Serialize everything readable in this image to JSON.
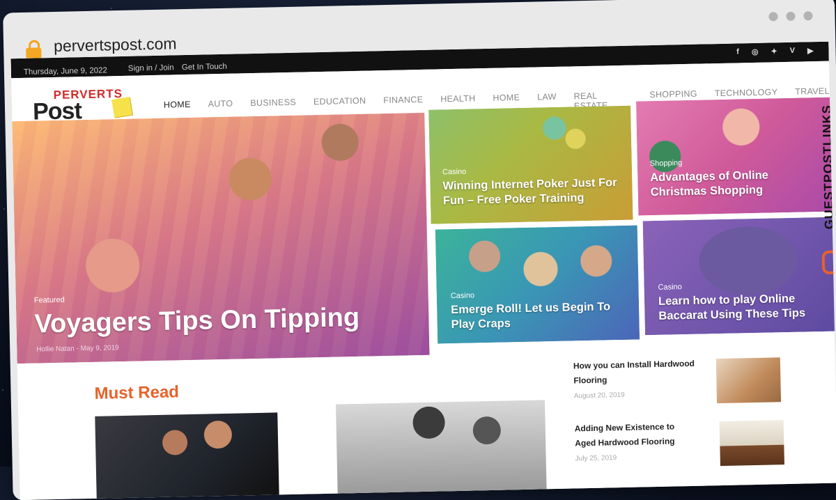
{
  "browser": {
    "url": "pervertspost.com"
  },
  "topbar": {
    "date": "Thursday, June 9, 2022",
    "signin": "Sign in / Join",
    "getintouch": "Get In Touch",
    "social": [
      {
        "icon": "facebook-icon",
        "glyph": "f"
      },
      {
        "icon": "instagram-icon",
        "glyph": "◎"
      },
      {
        "icon": "twitter-icon",
        "glyph": "✦"
      },
      {
        "icon": "vimeo-icon",
        "glyph": "V"
      },
      {
        "icon": "youtube-icon",
        "glyph": "▶"
      }
    ]
  },
  "logo": {
    "line1": "PERVERTS",
    "line2": "Post"
  },
  "nav": [
    "HOME",
    "AUTO",
    "BUSINESS",
    "EDUCATION",
    "FINANCE",
    "HEALTH",
    "HOME",
    "LAW",
    "REAL ESTATE",
    "SHOPPING",
    "TECHNOLOGY",
    "TRAVEL"
  ],
  "hero": {
    "category": "Featured",
    "title": "Voyagers Tips On Tipping",
    "author": "Hollie Natan",
    "sep": "-",
    "date": "May 9, 2019"
  },
  "tiles": {
    "poker": {
      "category": "Casino",
      "title": "Winning Internet Poker Just For Fun – Free Poker Training"
    },
    "xmas": {
      "category": "Shopping",
      "title": "Advantages of Online Christmas Shopping"
    },
    "craps": {
      "category": "Casino",
      "title": "Emerge Roll! Let us Begin To Play Craps"
    },
    "baccarat": {
      "category": "Casino",
      "title": "Learn how to play Online Baccarat Using These Tips"
    }
  },
  "mustread": {
    "heading": "Must Read"
  },
  "sidebar": [
    {
      "title": "How you can Install Hardwood Flooring",
      "date": "August 20, 2019"
    },
    {
      "title": "Adding New Existence to Aged Hardwood Flooring",
      "date": "July 25, 2019"
    }
  ],
  "watermark": {
    "text": "GUESTPOSTLINKS"
  },
  "colors": {
    "accent": "#e8622a",
    "topbar": "#111111"
  }
}
